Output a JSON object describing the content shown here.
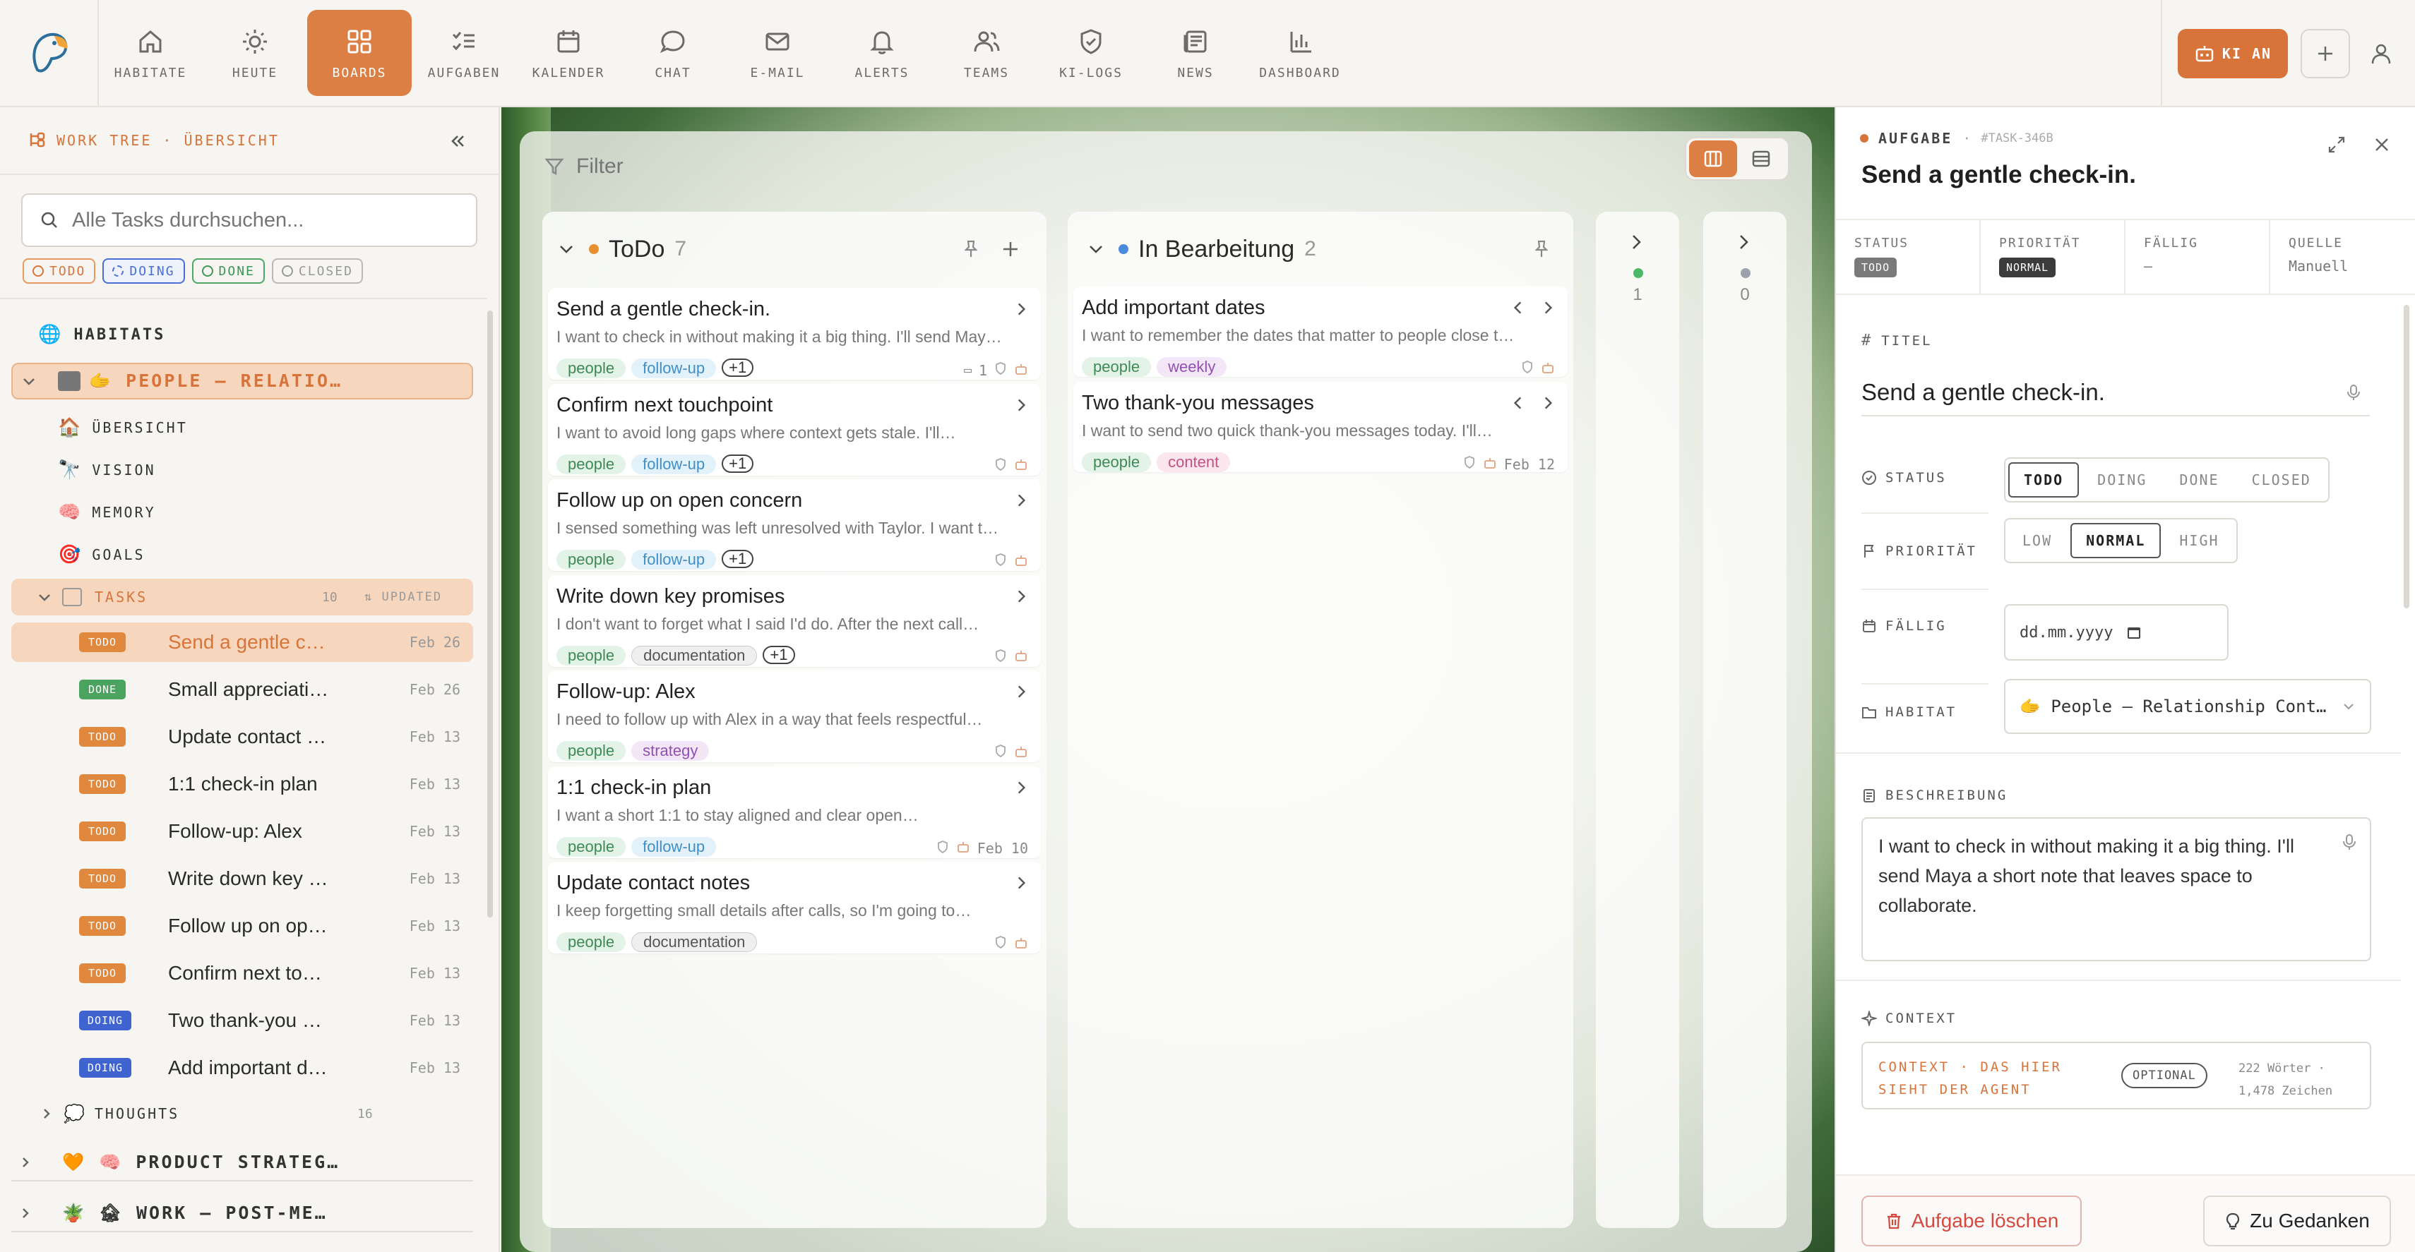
{
  "nav": {
    "items": [
      {
        "label": "HABITATE",
        "icon": "home-icon"
      },
      {
        "label": "HEUTE",
        "icon": "sun-icon"
      },
      {
        "label": "BOARDS",
        "icon": "grid-icon"
      },
      {
        "label": "AUFGABEN",
        "icon": "checklist-icon"
      },
      {
        "label": "KALENDER",
        "icon": "calendar-icon"
      },
      {
        "label": "CHAT",
        "icon": "chat-icon"
      },
      {
        "label": "E-MAIL",
        "icon": "mail-icon"
      },
      {
        "label": "ALERTS",
        "icon": "bell-icon"
      },
      {
        "label": "TEAMS",
        "icon": "team-icon"
      },
      {
        "label": "KI-LOGS",
        "icon": "shield-icon"
      },
      {
        "label": "NEWS",
        "icon": "newspaper-icon"
      },
      {
        "label": "DASHBOARD",
        "icon": "bar-chart-icon"
      }
    ],
    "active": "BOARDS",
    "ki_label": "KI AN",
    "accent": "#dc7f45"
  },
  "sidebar": {
    "header": "WORK TREE · ÜBERSICHT",
    "search_placeholder": "Alle Tasks durchsuchen...",
    "filters": [
      "TODO",
      "DOING",
      "DONE",
      "CLOSED"
    ],
    "habitats_label": "HABITATS",
    "habitat_people": "🫱 PEOPLE — RELATIO…",
    "sections": [
      {
        "label": "ÜBERSICHT",
        "icon": "🏠"
      },
      {
        "label": "VISION",
        "icon": "🔭"
      },
      {
        "label": "MEMORY",
        "icon": "🧠"
      },
      {
        "label": "GOALS",
        "icon": "🎯"
      }
    ],
    "tasks_label": "TASKS",
    "tasks_count": "10",
    "tasks_sort": "UPDATED",
    "tasks": [
      {
        "status": "TODO",
        "title": "Send a gentle c…",
        "date": "Feb 26"
      },
      {
        "status": "DONE",
        "title": "Small appreciati…",
        "date": "Feb 26"
      },
      {
        "status": "TODO",
        "title": "Update contact …",
        "date": "Feb 13"
      },
      {
        "status": "TODO",
        "title": "1:1 check-in plan",
        "date": "Feb 13"
      },
      {
        "status": "TODO",
        "title": "Follow-up: Alex",
        "date": "Feb 13"
      },
      {
        "status": "TODO",
        "title": "Write down key …",
        "date": "Feb 13"
      },
      {
        "status": "TODO",
        "title": "Follow up on op…",
        "date": "Feb 13"
      },
      {
        "status": "TODO",
        "title": "Confirm next to…",
        "date": "Feb 13"
      },
      {
        "status": "DOING",
        "title": "Two thank-you …",
        "date": "Feb 13"
      },
      {
        "status": "DOING",
        "title": "Add important d…",
        "date": "Feb 13"
      }
    ],
    "thoughts_label": "THOUGHTS",
    "thoughts_count": "16",
    "habitat_product": "🧡 🧠 PRODUCT STRATEG…",
    "habitat_work": "🪴 🏚 WORK — POST-ME…"
  },
  "board": {
    "filter_placeholder": "Filter",
    "columns": {
      "todo": {
        "name": "ToDo",
        "count": "7"
      },
      "doing": {
        "name": "In Bearbeitung",
        "count": "2"
      },
      "c3": {
        "count": "1"
      },
      "c4": {
        "count": "0"
      }
    },
    "todo_cards": [
      {
        "title": "Send a gentle check-in.",
        "desc": "I want to check in without making it a big thing. I'll send May…",
        "tags": [
          [
            "people",
            "t-people"
          ],
          [
            "follow-up",
            "t-follow"
          ],
          [
            "+1",
            "t-plus"
          ]
        ],
        "meta": "1",
        "date": ""
      },
      {
        "title": "Confirm next touchpoint",
        "desc": "I want to avoid long gaps where context gets stale. I'll…",
        "tags": [
          [
            "people",
            "t-people"
          ],
          [
            "follow-up",
            "t-follow"
          ],
          [
            "+1",
            "t-plus"
          ]
        ],
        "meta": "",
        "date": ""
      },
      {
        "title": "Follow up on open concern",
        "desc": "I sensed something was left unresolved with Taylor. I want t…",
        "tags": [
          [
            "people",
            "t-people"
          ],
          [
            "follow-up",
            "t-follow"
          ],
          [
            "+1",
            "t-plus"
          ]
        ],
        "meta": "",
        "date": ""
      },
      {
        "title": "Write down key promises",
        "desc": "I don't want to forget what I said I'd do. After the next call…",
        "tags": [
          [
            "people",
            "t-people"
          ],
          [
            "documentation",
            "t-doc"
          ],
          [
            "+1",
            "t-plus"
          ]
        ],
        "meta": "",
        "date": ""
      },
      {
        "title": "Follow-up: Alex",
        "desc": "I need to follow up with Alex in a way that feels respectful…",
        "tags": [
          [
            "people",
            "t-people"
          ],
          [
            "strategy",
            "t-strat"
          ]
        ],
        "meta": "",
        "date": ""
      },
      {
        "title": "1:1 check-in plan",
        "desc": "I want a short 1:1 to stay aligned and clear open…",
        "tags": [
          [
            "people",
            "t-people"
          ],
          [
            "follow-up",
            "t-follow"
          ]
        ],
        "meta": "",
        "date": "Feb 10"
      },
      {
        "title": "Update contact notes",
        "desc": "I keep forgetting small details after calls, so I'm going to…",
        "tags": [
          [
            "people",
            "t-people"
          ],
          [
            "documentation",
            "t-doc"
          ]
        ],
        "meta": "",
        "date": ""
      }
    ],
    "doing_cards": [
      {
        "title": "Add important dates",
        "desc": "I want to remember the dates that matter to people close t…",
        "tags": [
          [
            "people",
            "t-people"
          ],
          [
            "weekly",
            "t-weekly"
          ]
        ],
        "date": ""
      },
      {
        "title": "Two thank-you messages",
        "desc": "I want to send two quick thank-you messages today. I'll…",
        "tags": [
          [
            "people",
            "t-people"
          ],
          [
            "content",
            "t-content"
          ]
        ],
        "date": "Feb 12"
      }
    ]
  },
  "detail": {
    "crumb_type": "AUFGABE",
    "crumb_id": "#TASK-346B",
    "title": "Send a gentle check-in.",
    "meta": {
      "status_label": "STATUS",
      "status": "TODO",
      "prio_label": "PRIORITÄT",
      "prio": "NORMAL",
      "due_label": "FÄLLIG",
      "due": "—",
      "source_label": "QUELLE",
      "source": "Manuell"
    },
    "titel_label": "TITEL",
    "titel_value": "Send a gentle check-in.",
    "status_label": "STATUS",
    "status_options": [
      "TODO",
      "DOING",
      "DONE",
      "CLOSED"
    ],
    "prio_label": "PRIORITÄT",
    "prio_options": [
      "LOW",
      "NORMAL",
      "HIGH"
    ],
    "faellig_label": "FÄLLIG",
    "date_placeholder": "dd.mm.yyyy",
    "habitat_label": "HABITAT",
    "habitat_value": "🫱 People — Relationship Cont…",
    "beschreibung_label": "BESCHREIBUNG",
    "beschreibung_value": "I want to check in without making it a big thing. I'll send Maya a short note that leaves space to collaborate.",
    "context_label": "CONTEXT",
    "context_placeholder": "CONTEXT · DAS HIER SIEHT DER AGENT",
    "context_optional": "OPTIONAL",
    "context_words": "222 Wörter ·",
    "context_chars": "1,478 Zeichen",
    "delete_label": "Aufgabe löschen",
    "thoughts_label": "Zu Gedanken"
  }
}
